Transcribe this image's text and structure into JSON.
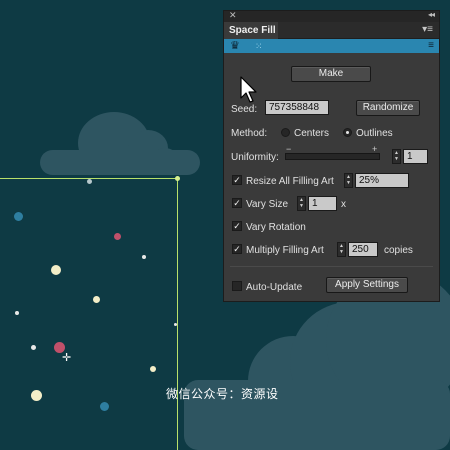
{
  "panel": {
    "title": "Space Fill",
    "menu_icon": "panel-menu-icon",
    "make_label": "Make",
    "seed_label": "Seed:",
    "seed_value": "757358848",
    "randomize_label": "Randomize",
    "method_label": "Method:",
    "method_options": [
      "Centers",
      "Outlines"
    ],
    "method_selected": "Outlines",
    "uniformity_label": "Uniformity:",
    "uniformity_minus": "−",
    "uniformity_plus": "+",
    "uniformity_value": "1",
    "resize_label": "Resize All Filling Art",
    "resize_checked": true,
    "resize_value": "25%",
    "vary_size_label": "Vary Size",
    "vary_size_checked": true,
    "vary_size_value": "1",
    "vary_size_unit": "x",
    "vary_rotation_label": "Vary Rotation",
    "vary_rotation_checked": true,
    "multiply_label": "Multiply Filling Art",
    "multiply_checked": true,
    "multiply_value": "250",
    "multiply_unit": "copies",
    "auto_update_label": "Auto-Update",
    "auto_update_checked": false,
    "apply_label": "Apply Settings"
  },
  "watermark": "微信公众号：资源设",
  "colors": {
    "background": "#0e3a44",
    "cloud": "#2e5561",
    "guide": "#b8e06a",
    "panel": "#3a3a3a",
    "accent_strip": "#2a86b0",
    "dot_cream": "#f3eec8",
    "dot_pink": "#c0506a",
    "dot_blue": "#2e7ea0"
  }
}
